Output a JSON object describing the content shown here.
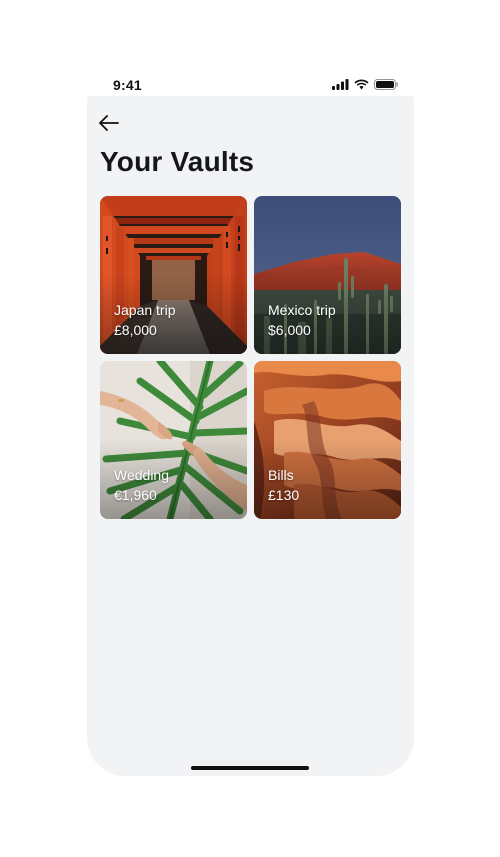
{
  "status_bar": {
    "time": "9:41",
    "icons": [
      "cellular-signal-icon",
      "wifi-icon",
      "battery-icon"
    ]
  },
  "nav": {
    "back_icon": "arrow-left-icon"
  },
  "page": {
    "title": "Your Vaults"
  },
  "vaults": [
    {
      "name": "Japan trip",
      "amount": "£8,000",
      "image": "torii-gates-photo"
    },
    {
      "name": "Mexico trip",
      "amount": "$6,000",
      "image": "desert-mountain-cactus-photo"
    },
    {
      "name": "Wedding",
      "amount": "€1,960",
      "image": "hands-palm-leaf-photo"
    },
    {
      "name": "Bills",
      "amount": "£130",
      "image": "sandstone-canyon-photo"
    }
  ],
  "colors": {
    "background": "#f2f3f5",
    "title": "#16171a",
    "card_text": "#ffffff"
  }
}
